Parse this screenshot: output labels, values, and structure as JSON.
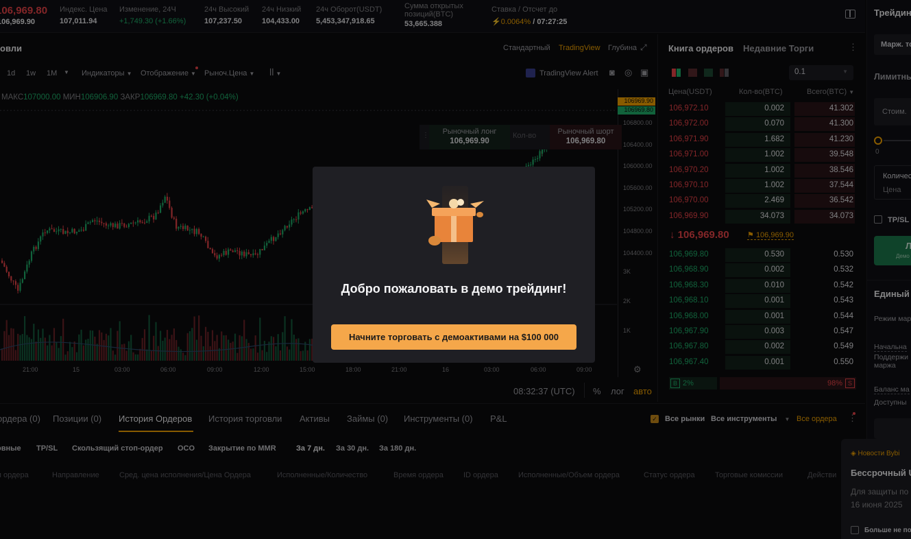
{
  "ticker": {
    "last_price": "106,969.80",
    "mark_price": "106,969.90",
    "index": {
      "label": "Индекс. Цена",
      "value": "107,011.94"
    },
    "change": {
      "label": "Изменение, 24Ч",
      "value": "+1,749.30 (+1.66%)"
    },
    "high": {
      "label": "24ч Высокий",
      "value": "107,237.50"
    },
    "low": {
      "label": "24ч Низкий",
      "value": "104,433.00"
    },
    "turnover": {
      "label": "24ч Оборот(USDT)",
      "value": "5,453,347,918.65"
    },
    "oi": {
      "label1": "Сумма открытых",
      "label2": "позиций(BTC)",
      "value": "53,665.388"
    },
    "funding": {
      "label": "Ставка / Отсчет до",
      "rate": "0.0064%",
      "countdown": "/ 07:27:25"
    }
  },
  "chart": {
    "title": "овли",
    "views": [
      "Стандартный",
      "TradingView",
      "Глубина"
    ],
    "active_view": "TradingView",
    "intervals": [
      "1d",
      "1w",
      "1M"
    ],
    "tools": [
      "Индикаторы",
      "Отображение",
      "Рыноч.Цена"
    ],
    "tv_alert": "TradingView Alert",
    "ohlc": {
      "max_label": "МАКС",
      "max": "107000.00",
      "min_label": "МИН",
      "min": "106906.90",
      "close_label": "ЗАКР",
      "close": "106969.80",
      "chg": "+42.30 (+0.04%)"
    },
    "price_ticks": [
      "106800.00",
      "106400.00",
      "106000.00",
      "105600.00",
      "105200.00",
      "104800.00",
      "104400.00"
    ],
    "price_tag_mark": "106969.90",
    "price_tag_last": "106969.80",
    "vol_ticks": [
      "3K",
      "2K",
      "1K"
    ],
    "time_ticks": [
      "21:00",
      "15",
      "03:00",
      "06:00",
      "09:00",
      "12:00",
      "15:00",
      "18:00",
      "21:00",
      "16",
      "03:00",
      "06:00",
      "09:00"
    ],
    "quick_long": {
      "label": "Рыночный лонг",
      "price": "106,969.90"
    },
    "quick_qty": "Кол-во",
    "quick_short": {
      "label": "Рыночный шорт",
      "price": "106,969.80"
    },
    "clock": "08:32:37 (UTC)",
    "scale_pct": "%",
    "scale_log": "лог",
    "scale_auto": "авто"
  },
  "book": {
    "tabs": [
      "Книга ордеров",
      "Недавние Торги"
    ],
    "tick_size": "0.1",
    "headers": {
      "price": "Цена(USDT)",
      "qty": "Кол-во(BTC)",
      "total": "Всего(BTC)"
    },
    "asks": [
      {
        "price": "106,972.10",
        "qty": "0.002",
        "total": "41.302",
        "depth": 0.77
      },
      {
        "price": "106,972.00",
        "qty": "0.070",
        "total": "41.300",
        "depth": 0.77
      },
      {
        "price": "106,971.90",
        "qty": "1.682",
        "total": "41.230",
        "depth": 0.77
      },
      {
        "price": "106,971.00",
        "qty": "1.002",
        "total": "39.548",
        "depth": 0.74
      },
      {
        "price": "106,970.20",
        "qty": "1.002",
        "total": "38.546",
        "depth": 0.72
      },
      {
        "price": "106,970.10",
        "qty": "1.002",
        "total": "37.544",
        "depth": 0.7
      },
      {
        "price": "106,970.00",
        "qty": "2.469",
        "total": "36.542",
        "depth": 0.68
      },
      {
        "price": "106,969.90",
        "qty": "34.073",
        "total": "34.073",
        "depth": 0.64
      }
    ],
    "last_price": "106,969.80",
    "mark_price": "106,969.90",
    "bids": [
      {
        "price": "106,969.80",
        "qty": "0.530",
        "total": "0.530"
      },
      {
        "price": "106,968.90",
        "qty": "0.002",
        "total": "0.532"
      },
      {
        "price": "106,968.30",
        "qty": "0.010",
        "total": "0.542"
      },
      {
        "price": "106,968.10",
        "qty": "0.001",
        "total": "0.543"
      },
      {
        "price": "106,968.00",
        "qty": "0.001",
        "total": "0.544"
      },
      {
        "price": "106,967.90",
        "qty": "0.003",
        "total": "0.547"
      },
      {
        "price": "106,967.80",
        "qty": "0.002",
        "total": "0.549"
      },
      {
        "price": "106,967.40",
        "qty": "0.001",
        "total": "0.550"
      }
    ],
    "buy_label": "B",
    "buy_pct": "2%",
    "sell_pct": "98%",
    "sell_label": "S",
    "buy_ratio": 0.02
  },
  "right_panel": {
    "title": "Трейдин",
    "margin": "Марж. то",
    "limit": "Лимитны",
    "cost": "Стоим.",
    "slider_min": "0",
    "qty": "Количес",
    "price": "Цена",
    "tpsl": "TP/SL",
    "long_btn": "Л",
    "long_sub": "Демо",
    "unified": "Единый",
    "mode": "Режим мар",
    "initial": "Начальна",
    "maint1": "Поддержи",
    "maint2": "маржа",
    "balance": "Баланс ма",
    "available": "Доступны"
  },
  "bottom": {
    "tabs": [
      "ордера (0)",
      "Позиции (0)",
      "История Ордеров",
      "История торговли",
      "Активы",
      "Займы (0)",
      "Инструменты (0)",
      "P&L"
    ],
    "active_tab": "История Ордеров",
    "all_markets": "Все рынки",
    "all_instruments": "Все инструменты",
    "all_orders": "Все ордера",
    "filters": [
      "овные",
      "TP/SL",
      "Скользящий стоп-ордер",
      "OCO",
      "Закрытие по MMR",
      "За 7 дн.",
      "За 30 дн.",
      "За 180 дн."
    ],
    "columns": [
      "п ордера",
      "Направление",
      "Сред. цена исполнения/Цена Ордера",
      "Исполненные/Количество",
      "Время ордера",
      "ID ордера",
      "Исполненные/Объем ордера",
      "Статус ордера",
      "Торговые комиссии",
      "Действи"
    ]
  },
  "news": {
    "label": "Новости Bybi",
    "title": "Бессрочный U",
    "body": "Для защиты по",
    "date": "16 июня 2025",
    "dont_show": "Больше не по"
  },
  "modal": {
    "title": "Добро пожаловать в демо трейдинг!",
    "button": "Начните торговать с демоактивами на $100 000"
  },
  "colors": {
    "green": "#20b26c",
    "red": "#ef454a",
    "accent": "#f7a600",
    "button": "#f5a74a"
  }
}
